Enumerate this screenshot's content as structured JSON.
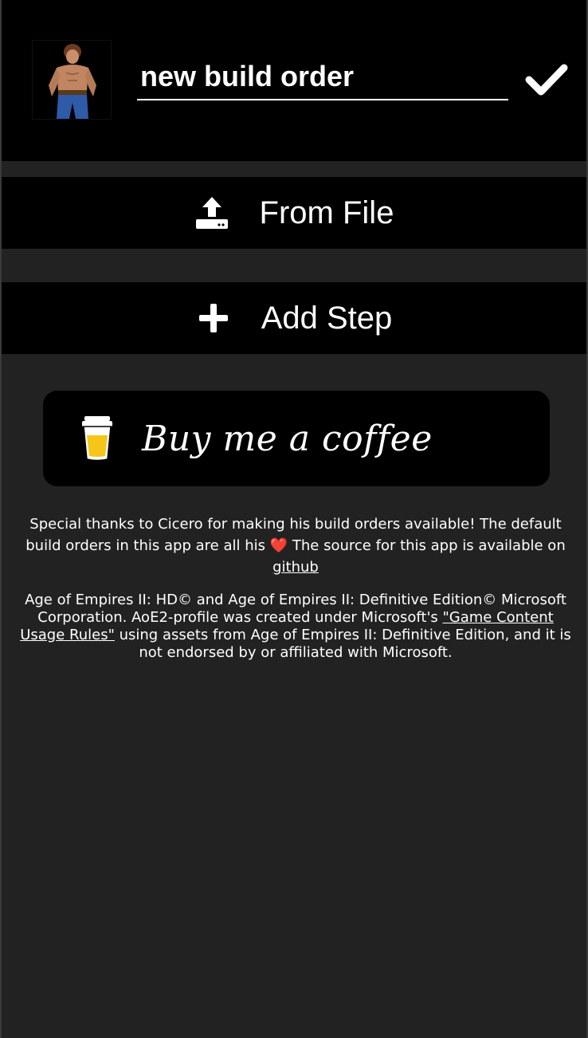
{
  "header": {
    "build_name": "new build order",
    "avatar_icon": "villager-portrait-icon",
    "confirm_icon": "checkmark-icon"
  },
  "actions": {
    "from_file": {
      "label": "From File",
      "icon": "upload-icon"
    },
    "add_step": {
      "label": "Add Step",
      "icon": "plus-icon"
    }
  },
  "coffee": {
    "label": "Buy me a coffee",
    "icon": "coffee-cup-icon"
  },
  "thanks": {
    "part1": "Special thanks to Cicero for making his build orders available! The default build orders in this app are all his",
    "heart": "❤️",
    "part2": "The source for this app is available on",
    "link": "github"
  },
  "legal": {
    "part1": "Age of Empires II: HD© and Age of Empires II: Definitive Edition© Microsoft Corporation. AoE2-profile was created under Microsoft's",
    "link": "\"Game Content Usage Rules\"",
    "part2": "using assets from Age of Empires II: Definitive Edition, and it is not endorsed by or affiliated with Microsoft."
  },
  "colors": {
    "background": "#222222",
    "panel": "#000000",
    "text": "#ffffff",
    "cup_fill": "#f5c518"
  }
}
